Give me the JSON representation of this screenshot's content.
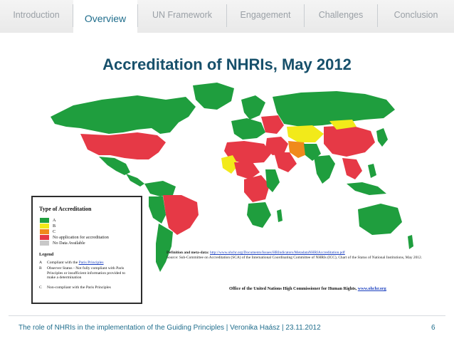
{
  "nav": {
    "tabs": [
      {
        "label": "Introduction"
      },
      {
        "label": "Overview"
      },
      {
        "label": "UN Framework"
      },
      {
        "label": "Engagement"
      },
      {
        "label": "Challenges"
      },
      {
        "label": "Conclusion"
      }
    ],
    "active_tab": "Overview"
  },
  "slide": {
    "title": "Accreditation of NHRIs, May 2012"
  },
  "legend": {
    "title": "Type of Accreditation",
    "items": [
      {
        "label": "A",
        "color": "#1f9e3e"
      },
      {
        "label": "B",
        "color": "#f2ea1a"
      },
      {
        "label": "C",
        "color": "#f08a1c"
      },
      {
        "label": "No application for accreditation",
        "color": "#e63946"
      },
      {
        "label": "No Data Available",
        "color": "#c8c8c8"
      }
    ],
    "subtitle": "Legend",
    "definitions": [
      {
        "key": "A",
        "text": "Compliant with the ",
        "link": "Paris Principles"
      },
      {
        "key": "B",
        "text": "Observer Status - Not fully compliant with Paris Principles or insufficient information provided to make a determination",
        "link": ""
      },
      {
        "key": "C",
        "text": "Non-compliant with the Paris Principles",
        "link": ""
      }
    ]
  },
  "metadata": {
    "label": "Definition and meta-data:",
    "url": "http://www.ohchr.org/Documents/Issues/HRIndicators/MetadataNHRIAccreditation.pdf",
    "source_text": "Source: Sub-Committee on Accreditation (SCA) of the International Coordinating Committee of NHRIs (ICC), Chart of the Status of National Institutions, May 2012.",
    "source_link": "Chart of the Status of National Institutions, May 2012"
  },
  "office": {
    "text": "Office of the United Nations High Commissioner for Human Rights,",
    "link": "www.ohchr.org"
  },
  "footer": {
    "text": "The role of NHRIs in the implementation of the Guiding Principles | Veronika Haász | 23.11.2012",
    "page": "6"
  },
  "colors": {
    "accent": "#1f6d8c",
    "title": "#17506b",
    "status_a": "#1f9e3e",
    "status_b": "#f2ea1a",
    "status_c": "#f08a1c",
    "status_none": "#e63946",
    "no_data": "#c8c8c8"
  }
}
